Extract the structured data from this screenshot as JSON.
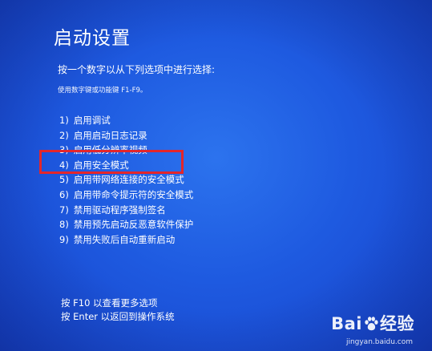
{
  "screen": {
    "title": "启动设置",
    "subtitle": "按一个数字以从下列选项中进行选择:",
    "hint": "使用数字键或功能键 F1-F9。"
  },
  "options": [
    {
      "num": "1)",
      "label": "启用调试"
    },
    {
      "num": "2)",
      "label": "启用启动日志记录"
    },
    {
      "num": "3)",
      "label": "启用低分辨率视频"
    },
    {
      "num": "4)",
      "label": "启用安全模式"
    },
    {
      "num": "5)",
      "label": "启用带网络连接的安全模式"
    },
    {
      "num": "6)",
      "label": "启用带命令提示符的安全模式"
    },
    {
      "num": "7)",
      "label": "禁用驱动程序强制签名"
    },
    {
      "num": "8)",
      "label": "禁用预先启动反恶意软件保护"
    },
    {
      "num": "9)",
      "label": "禁用失败后自动重新启动"
    }
  ],
  "footer": {
    "line1": "按 F10 以查看更多选项",
    "line2": "按 Enter 以返回到操作系统"
  },
  "watermark": {
    "logo_left": "Bai",
    "logo_right": "经验",
    "url": "jingyan.baidu.com"
  },
  "colors": {
    "background": "#1e5ae0",
    "text": "#ffffff",
    "highlight_border": "#e3262b"
  }
}
